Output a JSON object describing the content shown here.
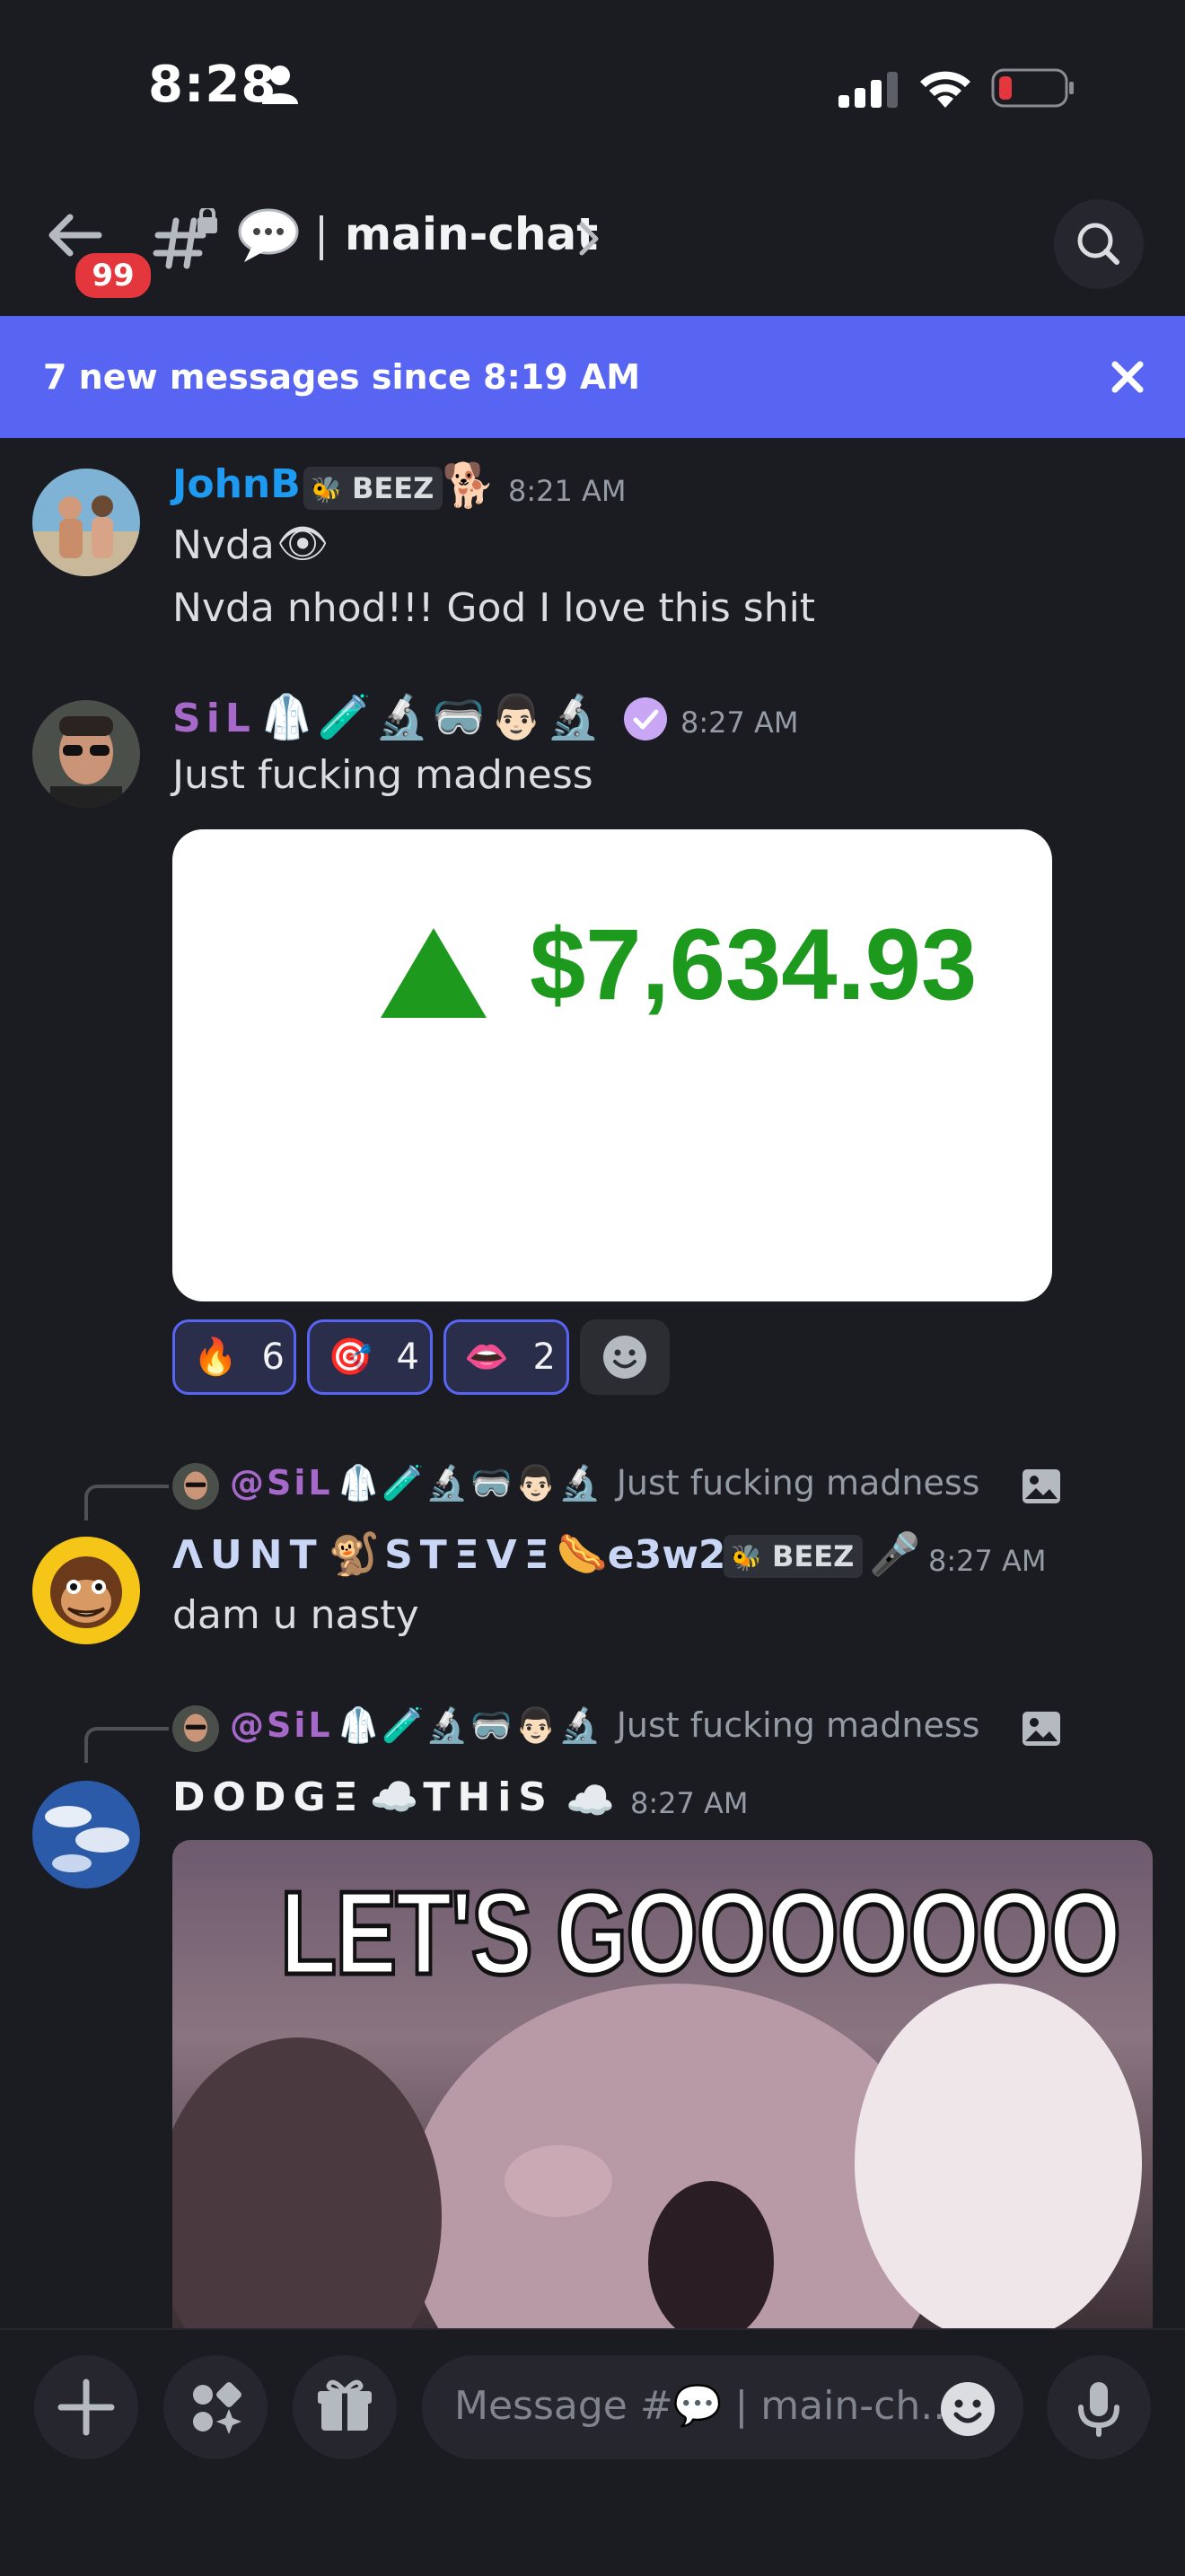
{
  "status_bar": {
    "time": "8:28"
  },
  "header": {
    "unread_count": "99",
    "channel_name": "main-chat"
  },
  "banner": {
    "text": "7 new messages since 8:19 AM"
  },
  "messages": [
    {
      "username": "JohnB",
      "tag": "BEEZ",
      "time": "8:21 AM",
      "lines": [
        "Nvda",
        "Nvda nhod!!! God I love this shit"
      ]
    },
    {
      "username": "SiL",
      "time": "8:27 AM",
      "text": "Just fucking madness",
      "image_text": "$7,634.93",
      "reactions": [
        {
          "emoji": "🔥",
          "count": "6"
        },
        {
          "emoji": "🎯",
          "count": "4"
        },
        {
          "emoji": "👄",
          "count": "2"
        }
      ]
    },
    {
      "reply_to": {
        "username": "@SiL",
        "text": "Just fucking madness"
      },
      "username_part1": "ΛUNT",
      "username_part2": "STΞVΞ",
      "username_part3": "e3w2",
      "tag": "BEEZ",
      "time": "8:27 AM",
      "text": "dam u nasty"
    },
    {
      "reply_to": {
        "username": "@SiL",
        "text": "Just fucking madness"
      },
      "username_part1": "DODGΞ",
      "username_part2": "THiS",
      "time": "8:27 AM",
      "gif_text": "LET'S GOOOOOOO"
    }
  ],
  "composer": {
    "placeholder_a": "Message #",
    "placeholder_b": "| main-ch.."
  },
  "colors": {
    "background": "#1b1c22",
    "banner": "#5865f2",
    "badge": "#e3373d",
    "johnb_name": "#1e9bf0",
    "sil_name": "#a769c9",
    "chart_green": "#1d9a1d"
  }
}
